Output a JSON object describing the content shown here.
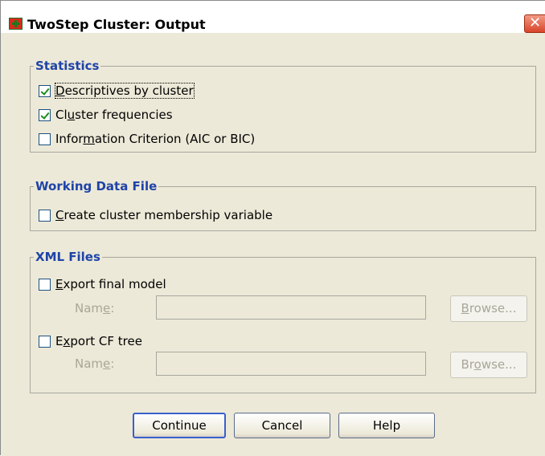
{
  "window": {
    "title": "TwoStep Cluster: Output",
    "close_glyph": "✕",
    "icon": "app-icon"
  },
  "statistics": {
    "legend": "Statistics",
    "items": [
      {
        "pre": "",
        "key": "D",
        "post": "escriptives by cluster",
        "checked": true
      },
      {
        "pre": "Cl",
        "key": "u",
        "post": "ster frequencies",
        "checked": true
      },
      {
        "pre": "Infor",
        "key": "m",
        "post": "ation Criterion (AIC or BIC)",
        "checked": false
      }
    ]
  },
  "working": {
    "legend": "Working Data File",
    "item": {
      "pre": "",
      "key": "C",
      "post": "reate cluster membership variable",
      "checked": false
    }
  },
  "xml": {
    "legend": "XML Files",
    "export_model": {
      "pre": "",
      "key": "E",
      "post": "xport final model",
      "checked": false
    },
    "name1": {
      "pre": "Nam",
      "key": "e",
      "post": ":",
      "value": ""
    },
    "browse1": {
      "pre": "",
      "key": "B",
      "post": "rowse..."
    },
    "export_tree": {
      "pre": "E",
      "key": "x",
      "post": "port CF tree",
      "checked": false
    },
    "name2": {
      "pre": "Nam",
      "key": "e",
      "post": ":",
      "value": ""
    },
    "browse2": {
      "pre": "Br",
      "key": "o",
      "post": "wse..."
    }
  },
  "buttons": {
    "continue": "Continue",
    "cancel": "Cancel",
    "help": "Help"
  },
  "colors": {
    "legend": "#1f44a8",
    "dialog_bg": "#ece9d8",
    "checkmark": "#1f8a1f",
    "close": "#d8452b"
  }
}
